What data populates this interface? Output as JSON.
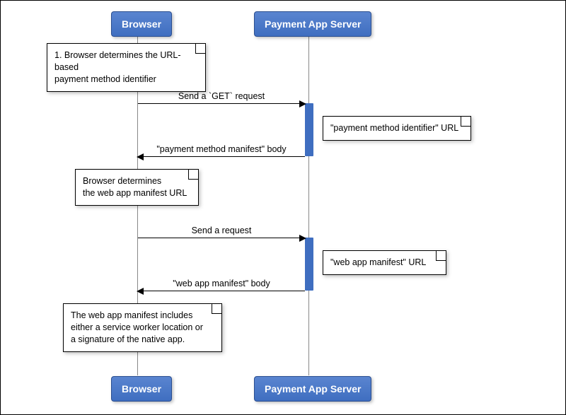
{
  "participants": {
    "left": "Browser",
    "right": "Payment App Server"
  },
  "notes": {
    "n1": "1. Browser determines the URL-based\npayment method identifier",
    "n2": "\"payment method identifier\" URL",
    "n3": "Browser determines\nthe web app manifest URL",
    "n4": "\"web app manifest\" URL",
    "n5": "The web app manifest includes\neither a service worker location or\na signature of the native app."
  },
  "messages": {
    "m1": "Send a `GET` request",
    "m2": "\"payment method manifest\" body",
    "m3": "Send a request",
    "m4": "\"web app manifest\" body"
  }
}
